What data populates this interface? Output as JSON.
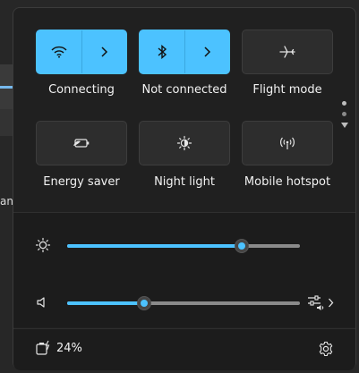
{
  "tiles": [
    {
      "label": "Connecting",
      "icon": "wifi-icon",
      "state": "on",
      "expandable": true
    },
    {
      "label": "Not connected",
      "icon": "bluetooth-icon",
      "state": "on",
      "expandable": true
    },
    {
      "label": "Flight mode",
      "icon": "airplane-icon",
      "state": "off",
      "expandable": false
    },
    {
      "label": "Energy saver",
      "icon": "energy-saver-icon",
      "state": "off",
      "expandable": false
    },
    {
      "label": "Night light",
      "icon": "night-light-icon",
      "state": "off",
      "expandable": false
    },
    {
      "label": "Mobile hotspot",
      "icon": "hotspot-icon",
      "state": "off",
      "expandable": false
    }
  ],
  "brightness": {
    "icon": "sun-icon",
    "level": 0.75
  },
  "volume": {
    "icon": "speaker-icon",
    "level": 0.33
  },
  "footer": {
    "battery_text": "24%",
    "battery_icon": "battery-charging-icon",
    "settings_icon": "gear-icon"
  },
  "colors": {
    "accent": "#4cc2ff",
    "panel": "#202020",
    "tile": "#2d2d2d"
  },
  "background": {
    "partial_text": "anc"
  }
}
